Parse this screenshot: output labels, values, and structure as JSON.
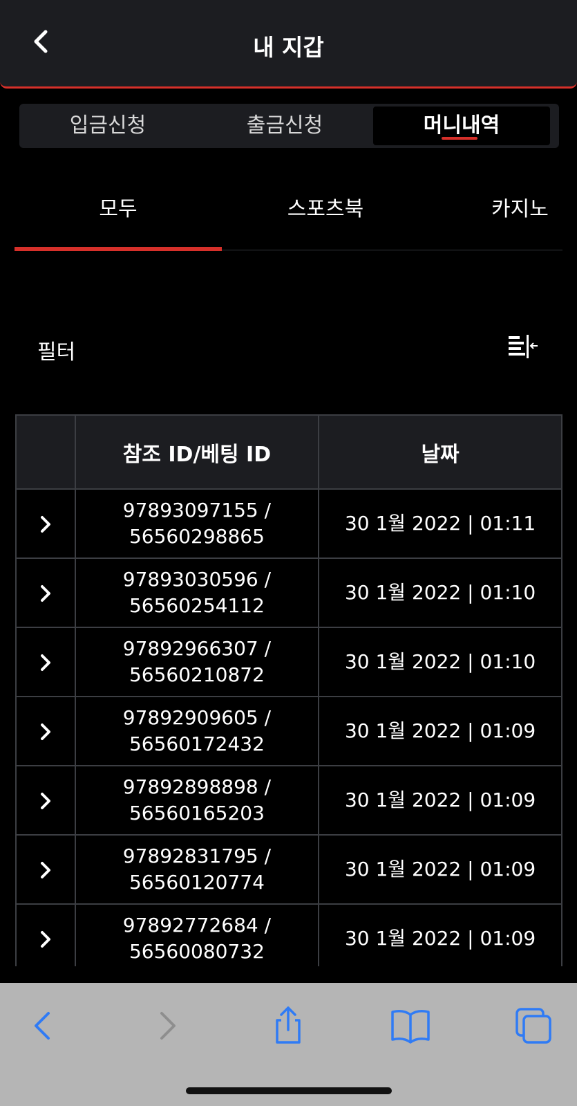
{
  "header": {
    "title": "내 지갑",
    "back_icon": "chevron-left-icon"
  },
  "segment": {
    "items": [
      {
        "label": "입금신청"
      },
      {
        "label": "출금신청"
      },
      {
        "label": "머니내역"
      }
    ],
    "active_index": 2
  },
  "subtabs": {
    "items": [
      {
        "label": "모두"
      },
      {
        "label": "스포츠북"
      },
      {
        "label": "카지노"
      }
    ],
    "active_index": 0
  },
  "filter": {
    "label": "필터",
    "icon": "filter-align-icon"
  },
  "table": {
    "headers": [
      "",
      "참조 ID/베팅 ID",
      "날짜"
    ],
    "rows": [
      {
        "ref": "97893097155 /",
        "bet": "56560298865",
        "date": "30 1월 2022 | 01:11"
      },
      {
        "ref": "97893030596 /",
        "bet": "56560254112",
        "date": "30 1월 2022 | 01:10"
      },
      {
        "ref": "97892966307 /",
        "bet": "56560210872",
        "date": "30 1월 2022 | 01:10"
      },
      {
        "ref": "97892909605 /",
        "bet": "56560172432",
        "date": "30 1월 2022 | 01:09"
      },
      {
        "ref": "97892898898 /",
        "bet": "56560165203",
        "date": "30 1월 2022 | 01:09"
      },
      {
        "ref": "97892831795 /",
        "bet": "56560120774",
        "date": "30 1월 2022 | 01:09"
      },
      {
        "ref": "97892772684 /",
        "bet": "56560080732",
        "date": "30 1월 2022 | 01:09"
      }
    ]
  },
  "browser_toolbar": {
    "icons": [
      "back-icon",
      "forward-icon",
      "share-icon",
      "bookmarks-icon",
      "tabs-icon"
    ]
  },
  "colors": {
    "accent": "#d6302a",
    "panel": "#1c1d21",
    "ios_blue": "#2f7bf5"
  }
}
